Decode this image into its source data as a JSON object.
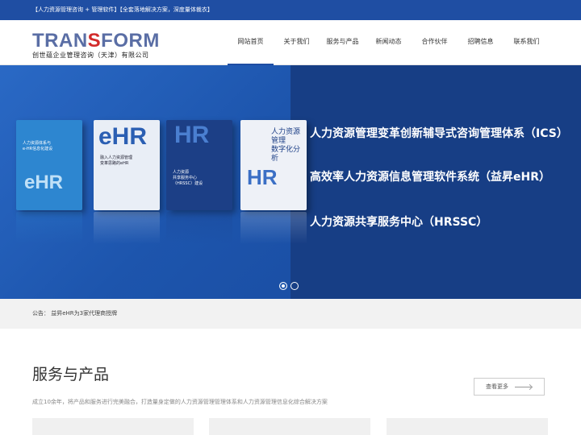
{
  "topbar": {
    "text": "【人力资源管理咨询 + 管理软件】【全套落地解决方案，深度量体裁衣】"
  },
  "logo": {
    "main_pre": "TRAN",
    "main_s": "S",
    "main_post": "FORM",
    "sub": "创世蕴企业管理咨询（天津）有限公司"
  },
  "nav": {
    "items": [
      "网站首页",
      "关于我们",
      "服务与产品",
      "新闻动态",
      "合作伙伴",
      "招聘信息",
      "联系我们"
    ],
    "active": 0
  },
  "banner": {
    "books": [
      {
        "title": "人力资源体系与\ne-HR信息化建设",
        "big": "eHR",
        "color": "#2d86d0"
      },
      {
        "title": "融入人力资源管理\n变革思路的eHR",
        "big": "eHR",
        "color": "#e9eef6"
      },
      {
        "title": "人力资源\n共享服务中心\n（HRSSC）建设",
        "big": "HR",
        "color": "#1c3f86"
      },
      {
        "title": "人力资源管理\n数字化分析",
        "big": "HR",
        "color": "#eef1f7"
      }
    ],
    "slogans": [
      "人力资源管理变革创新辅导式咨询管理体系（ICS）",
      "高效率人力资源信息管理软件系统（益昇eHR）",
      "人力资源共享服务中心（HRSSC）"
    ],
    "slide_count": 2,
    "active_slide": 0
  },
  "notice": {
    "text": "公告： 益昇eHR为3家代理商授牌"
  },
  "services": {
    "title": "服务与产品",
    "desc": "成立10余年，将产品和服务进行完美融合，打造量身定做的人力资源管理管理体系和人力资源管理信息化综合解决方案",
    "more_label": "查看更多"
  },
  "colors": {
    "brand": "#1f4ea3",
    "banner_dark": "#173e85",
    "logo_s": "#d22b2b"
  }
}
